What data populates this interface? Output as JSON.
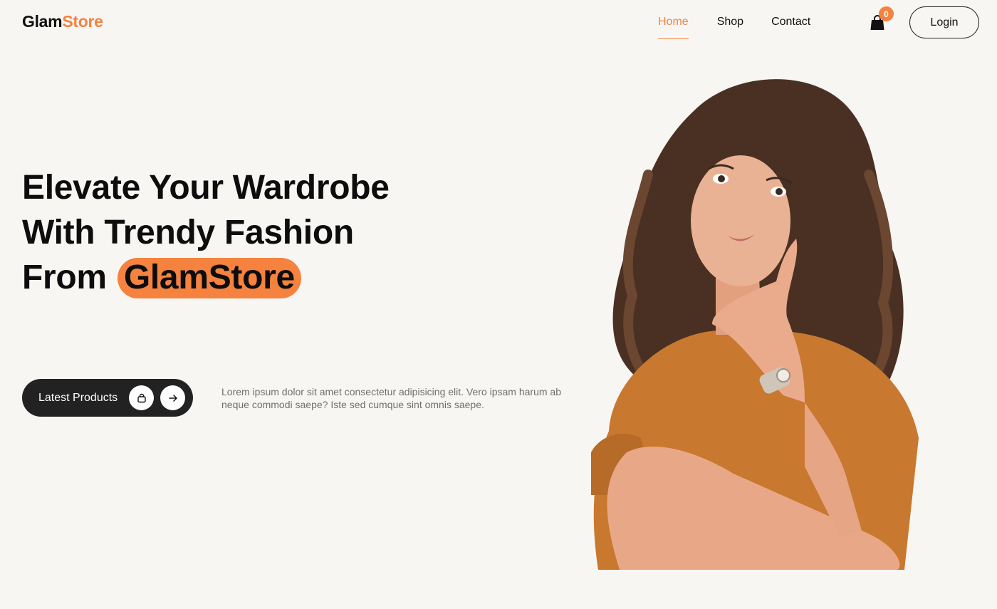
{
  "brand": {
    "part1": "Glam",
    "part2": "Store"
  },
  "nav": {
    "items": [
      "Home",
      "Shop",
      "Contact"
    ],
    "active": "Home"
  },
  "cart": {
    "count": "0",
    "icon": "shopping-bag-icon"
  },
  "login_label": "Login",
  "hero": {
    "title_line1": "Elevate Your Wardrobe",
    "title_line2": "With Trendy Fashion",
    "title_line3_prefix": "From",
    "title_highlight": "GlamStore",
    "cta_label": "Latest Products",
    "cta_icons": [
      "shopping-bag-icon",
      "arrow-right-icon"
    ],
    "description": "Lorem ipsum dolor sit amet consectetur adipisicing elit. Vero ipsam harum ab neque commodi saepe? Iste sed cumque sint omnis saepe."
  },
  "colors": {
    "accent": "#f5823f",
    "dark": "#222222",
    "background": "#f8f6f3"
  }
}
